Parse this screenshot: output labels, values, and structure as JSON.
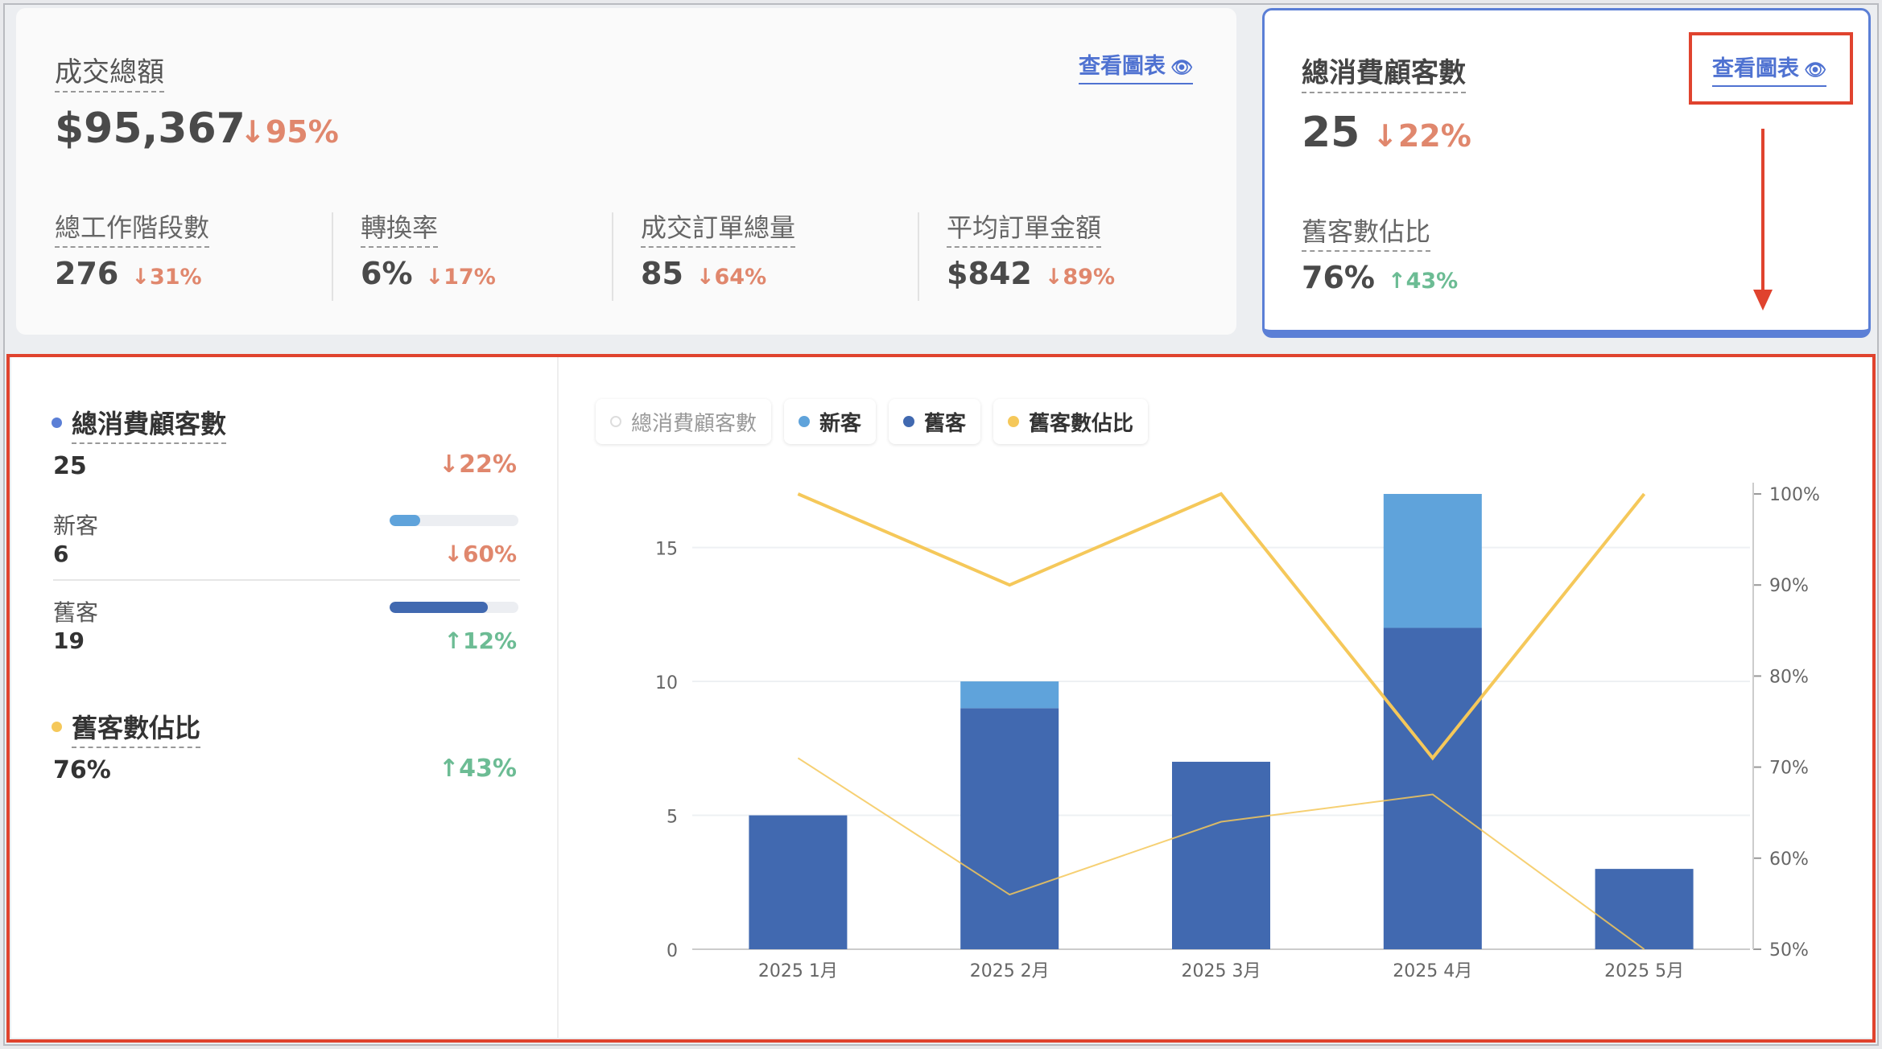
{
  "revenue_card": {
    "title": "成交總額",
    "value": "$95,367",
    "delta": "↓95%",
    "view_link": "查看圖表",
    "metrics": [
      {
        "label": "總工作階段數",
        "value": "276",
        "delta": "↓31%"
      },
      {
        "label": "轉換率",
        "value": "6%",
        "delta": "↓17%"
      },
      {
        "label": "成交訂單總量",
        "value": "85",
        "delta": "↓64%"
      },
      {
        "label": "平均訂單金額",
        "value": "$842",
        "delta": "↓89%"
      }
    ]
  },
  "customer_card": {
    "title": "總消費顧客數",
    "value": "25",
    "delta": "↓22%",
    "view_link": "查看圖表",
    "sub_label": "舊客數佔比",
    "sub_value": "76%",
    "sub_delta": "↑43%"
  },
  "breakdown": {
    "total_title": "總消費顧客數",
    "total_value": "25",
    "total_delta": "↓22%",
    "new_label": "新客",
    "new_value": "6",
    "new_delta": "↓60%",
    "new_bar_fraction": 0.24,
    "returning_label": "舊客",
    "returning_value": "19",
    "returning_delta": "↑12%",
    "returning_bar_fraction": 0.76,
    "ratio_title": "舊客數佔比",
    "ratio_value": "76%",
    "ratio_delta": "↑43%"
  },
  "colors": {
    "new": "#5fa3db",
    "returning": "#4169b0",
    "ratio": "#f5c85a",
    "total_dot": "#5b7fd6",
    "down": "#e0876d",
    "up": "#6cbc94"
  },
  "legend": [
    {
      "label": "總消費顧客數",
      "color": "#ffffff",
      "active": false
    },
    {
      "label": "新客",
      "color": "#5fa3db",
      "active": true
    },
    {
      "label": "舊客",
      "color": "#4169b0",
      "active": true
    },
    {
      "label": "舊客數佔比",
      "color": "#f5c85a",
      "active": true
    }
  ],
  "chart_data": {
    "type": "bar",
    "stacked": true,
    "categories": [
      "2025 1月",
      "2025 2月",
      "2025 3月",
      "2025 4月",
      "2025 5月"
    ],
    "series": [
      {
        "name": "舊客",
        "type": "bar",
        "axis": "left",
        "values": [
          5,
          9,
          7,
          12,
          3
        ]
      },
      {
        "name": "新客",
        "type": "bar",
        "axis": "left",
        "values": [
          0,
          1,
          0,
          5,
          0
        ]
      },
      {
        "name": "舊客數佔比",
        "type": "line",
        "axis": "right",
        "values": [
          100,
          90,
          100,
          71,
          100
        ]
      },
      {
        "type": "line",
        "axis": "right",
        "values": [
          71,
          56,
          64,
          67,
          50
        ]
      }
    ],
    "ylim_left": [
      0,
      17
    ],
    "yticks_left": [
      0,
      5,
      10,
      15
    ],
    "ylim_right": [
      50,
      100
    ],
    "yticks_right": [
      "50%",
      "60%",
      "70%",
      "80%",
      "90%",
      "100%"
    ],
    "grid": true
  }
}
